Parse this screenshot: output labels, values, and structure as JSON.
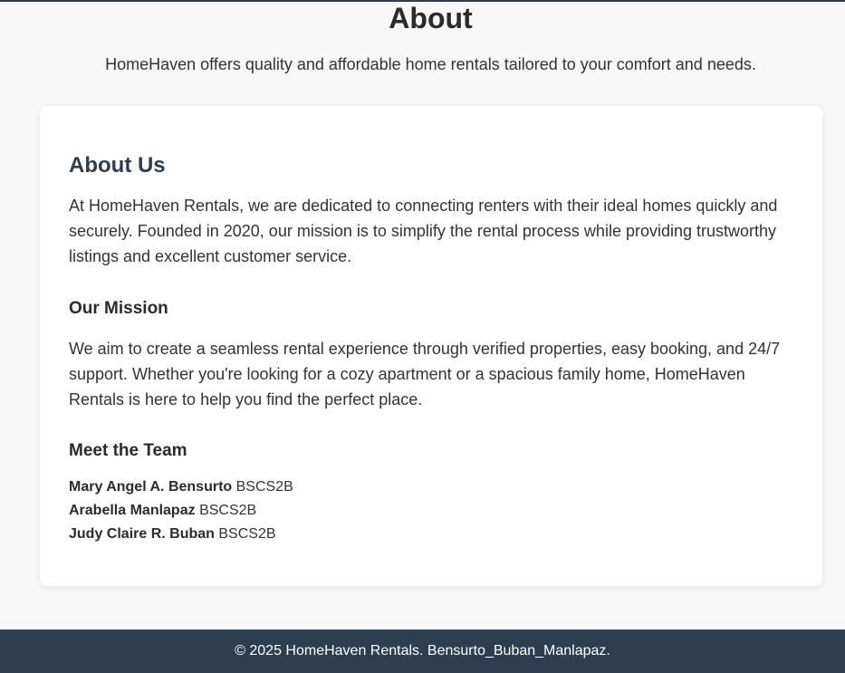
{
  "hero": {
    "title": "About",
    "subtitle": "HomeHaven offers quality and affordable home rentals tailored to your comfort and needs."
  },
  "about": {
    "heading": "About Us",
    "paragraph": "At HomeHaven Rentals, we are dedicated to connecting renters with their ideal homes quickly and securely. Founded in 2020, our mission is to simplify the rental process while providing trustworthy listings and excellent customer service."
  },
  "mission": {
    "heading": "Our Mission",
    "paragraph": "We aim to create a seamless rental experience through verified properties, easy booking, and 24/7 support. Whether you're looking for a cozy apartment or a spacious family home, HomeHaven Rentals is here to help you find the perfect place."
  },
  "team": {
    "heading": "Meet the Team",
    "members": [
      {
        "name": "Mary Angel A. Bensurto",
        "section": "BSCS2B"
      },
      {
        "name": "Arabella Manlapaz",
        "section": "BSCS2B"
      },
      {
        "name": "Judy Claire R. Buban",
        "section": "BSCS2B"
      }
    ]
  },
  "footer": {
    "text": "© 2025 HomeHaven Rentals. Bensurto_Buban_Manlapaz."
  }
}
